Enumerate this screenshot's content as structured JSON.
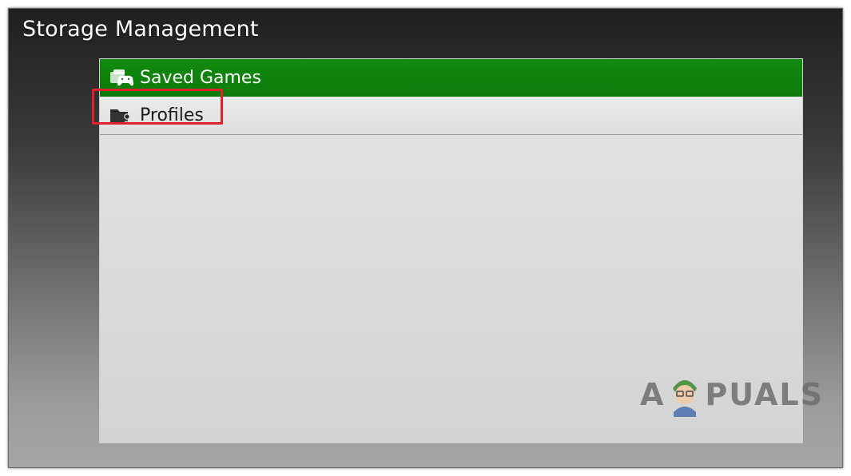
{
  "screen": {
    "title": "Storage Management"
  },
  "menu": {
    "items": [
      {
        "label": "Saved Games",
        "icon": "saved-games-icon",
        "selected": true
      },
      {
        "label": "Profiles",
        "icon": "profiles-icon",
        "selected": false
      }
    ]
  },
  "watermark": {
    "prefix": "A",
    "suffix": "PUALS"
  },
  "colors": {
    "selected_bg": "#0f820c",
    "highlight_box": "#e0202a",
    "panel_bg": "#dcdcdd"
  }
}
